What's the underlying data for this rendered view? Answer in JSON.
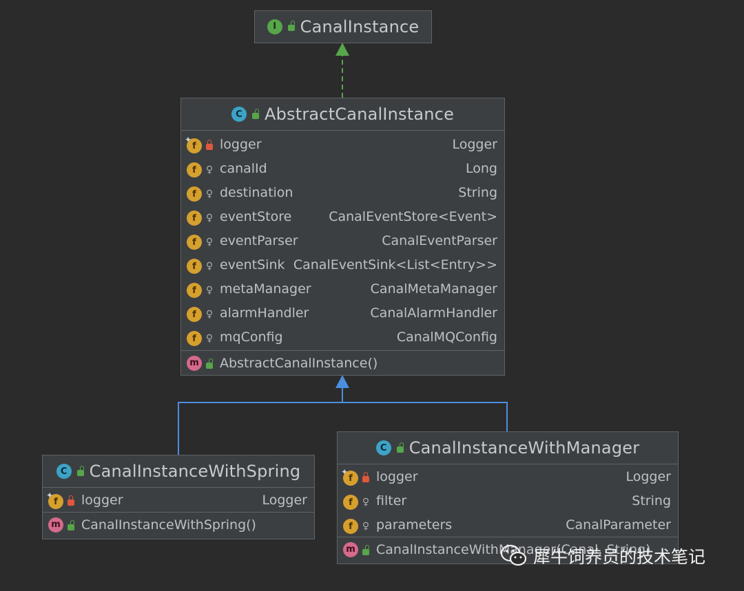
{
  "interface_box": {
    "name": "CanalInstance",
    "kind_icon": "interface-icon",
    "kind_letter": "I",
    "visibility": "public"
  },
  "abstract_box": {
    "name": "AbstractCanalInstance",
    "kind_icon": "class-icon",
    "kind_letter": "C",
    "fields": [
      {
        "name": "logger",
        "type": "Logger",
        "visibility": "private",
        "static": true
      },
      {
        "name": "canalId",
        "type": "Long",
        "visibility": "protected",
        "static": false
      },
      {
        "name": "destination",
        "type": "String",
        "visibility": "protected",
        "static": false
      },
      {
        "name": "eventStore",
        "type": "CanalEventStore<Event>",
        "visibility": "protected",
        "static": false
      },
      {
        "name": "eventParser",
        "type": "CanalEventParser",
        "visibility": "protected",
        "static": false
      },
      {
        "name": "eventSink",
        "type": "CanalEventSink<List<Entry>>",
        "visibility": "protected",
        "static": false
      },
      {
        "name": "metaManager",
        "type": "CanalMetaManager",
        "visibility": "protected",
        "static": false
      },
      {
        "name": "alarmHandler",
        "type": "CanalAlarmHandler",
        "visibility": "protected",
        "static": false
      },
      {
        "name": "mqConfig",
        "type": "CanalMQConfig",
        "visibility": "protected",
        "static": false
      }
    ],
    "methods": [
      {
        "name": "AbstractCanalInstance()",
        "visibility": "public"
      }
    ]
  },
  "spring_box": {
    "name": "CanalInstanceWithSpring",
    "kind_icon": "class-icon",
    "kind_letter": "C",
    "fields": [
      {
        "name": "logger",
        "type": "Logger",
        "visibility": "private",
        "static": true
      }
    ],
    "methods": [
      {
        "name": "CanalInstanceWithSpring()",
        "visibility": "public"
      }
    ]
  },
  "manager_box": {
    "name": "CanalInstanceWithManager",
    "kind_icon": "class-icon",
    "kind_letter": "C",
    "fields": [
      {
        "name": "logger",
        "type": "Logger",
        "visibility": "private",
        "static": true
      },
      {
        "name": "filter",
        "type": "String",
        "visibility": "protected",
        "static": false
      },
      {
        "name": "parameters",
        "type": "CanalParameter",
        "visibility": "protected",
        "static": false
      }
    ],
    "methods": [
      {
        "name": "CanalInstanceWithManager(Canal, String)",
        "visibility": "public"
      }
    ]
  },
  "relations": [
    {
      "from": "AbstractCanalInstance",
      "to": "CanalInstance",
      "kind": "implements",
      "style": "dashed",
      "color": "#57a64a"
    },
    {
      "from": "CanalInstanceWithSpring",
      "to": "AbstractCanalInstance",
      "kind": "extends",
      "style": "solid",
      "color": "#4a8fe0"
    },
    {
      "from": "CanalInstanceWithManager",
      "to": "AbstractCanalInstance",
      "kind": "extends",
      "style": "solid",
      "color": "#4a8fe0"
    }
  ],
  "field_letter": "f",
  "method_letter": "m",
  "watermark": {
    "text": "犀牛饲养员的技术笔记",
    "icon": "wechat-icon"
  },
  "colors": {
    "background": "#2b2b2b",
    "box": "#3c3f41",
    "border": "#5e6366",
    "implements_arrow": "#57a64a",
    "extends_arrow": "#4a8fe0"
  }
}
